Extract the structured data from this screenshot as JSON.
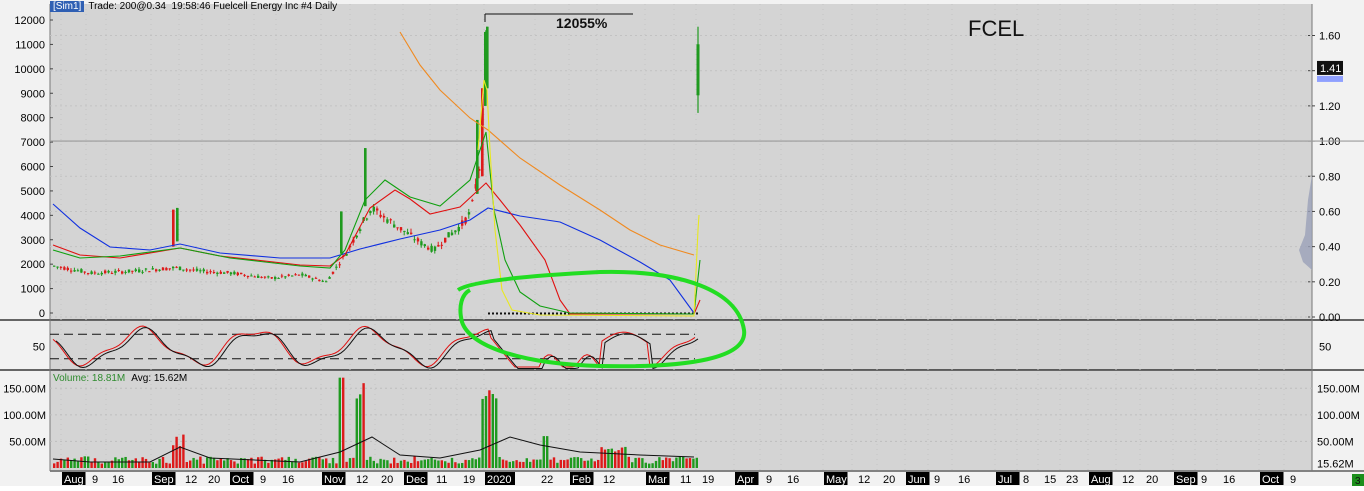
{
  "header": {
    "account_badge": "[Sim1]",
    "trade_info": "Trade: 200@0.34",
    "title": "19:58:46 Fuelcell Energy Inc #4 Daily"
  },
  "ticker_label": "FCEL",
  "annotation_pct": "12055%",
  "last_price_badge": "1.41",
  "volume_panel": {
    "volume_text": "Volume: 18.81M",
    "avg_text": "Avg: 15.62M",
    "right_value": "15.62M"
  },
  "bottom_right_badge": "3",
  "colors": {
    "up_candle": "#1f9a1f",
    "down_candle": "#dd1a1a",
    "ma_blue": "#1030e0",
    "ma_orange": "#f08a20",
    "ma_red": "#e01010",
    "ma_green": "#10a010",
    "ma_yellow": "#e8e820",
    "circle_annotation": "#22dd22",
    "volume_avg": "#111111",
    "badge_blue": "#2f5fb3"
  },
  "chart_data": [
    {
      "type": "line",
      "title": "Fuelcell Energy Inc #4 Daily",
      "y_left_ticks": [
        "12000",
        "11000",
        "10000",
        "9000",
        "8000",
        "7000",
        "6000",
        "5000",
        "4000",
        "3000",
        "2000",
        "1000",
        "0"
      ],
      "y_right_ticks": [
        "1.60",
        "1.40",
        "1.20",
        "1.00",
        "0.80",
        "0.60",
        "0.40",
        "0.20",
        "0.00"
      ],
      "ylim_right": [
        0,
        1.75
      ],
      "x_tick_labels": [
        "Aug",
        "9",
        "16",
        "Sep",
        "12",
        "20",
        "Oct",
        "9",
        "16",
        "Nov",
        "12",
        "20",
        "Dec",
        "11",
        "19",
        "2020",
        "22",
        "Feb",
        "12",
        "Mar",
        "11",
        "19",
        "Apr",
        "9",
        "16",
        "May",
        "12",
        "20",
        "Jun",
        "9",
        "16",
        "Jul",
        "8",
        "15",
        "23",
        "Aug",
        "12",
        "20",
        "Sep",
        "9",
        "16",
        "Oct",
        "9"
      ],
      "series": [
        {
          "x": [
            "Aug",
            "Sep",
            "Oct",
            "Nov",
            "Nov 12",
            "Nov 20",
            "Dec",
            "Dec 11",
            "Dec 19",
            "2020"
          ],
          "values": [
            0.26,
            0.25,
            0.25,
            0.23,
            0.43,
            0.61,
            0.46,
            0.4,
            0.55,
            1.63
          ]
        },
        {
          "x": [
            "Mar 19"
          ],
          "values": [
            1.41
          ]
        }
      ],
      "annotations": [
        "12055%",
        "FCEL"
      ]
    },
    {
      "type": "line",
      "ylim": [
        0,
        100
      ],
      "y_ticks": [
        "50"
      ],
      "reference_lines": [
        20,
        80
      ]
    },
    {
      "type": "bar",
      "y_ticks": [
        "150.00M",
        "100.00M",
        "50.00M"
      ],
      "ylim": [
        0,
        175
      ],
      "latest_volume_M": 18.81,
      "average_volume_M": 15.62
    }
  ]
}
